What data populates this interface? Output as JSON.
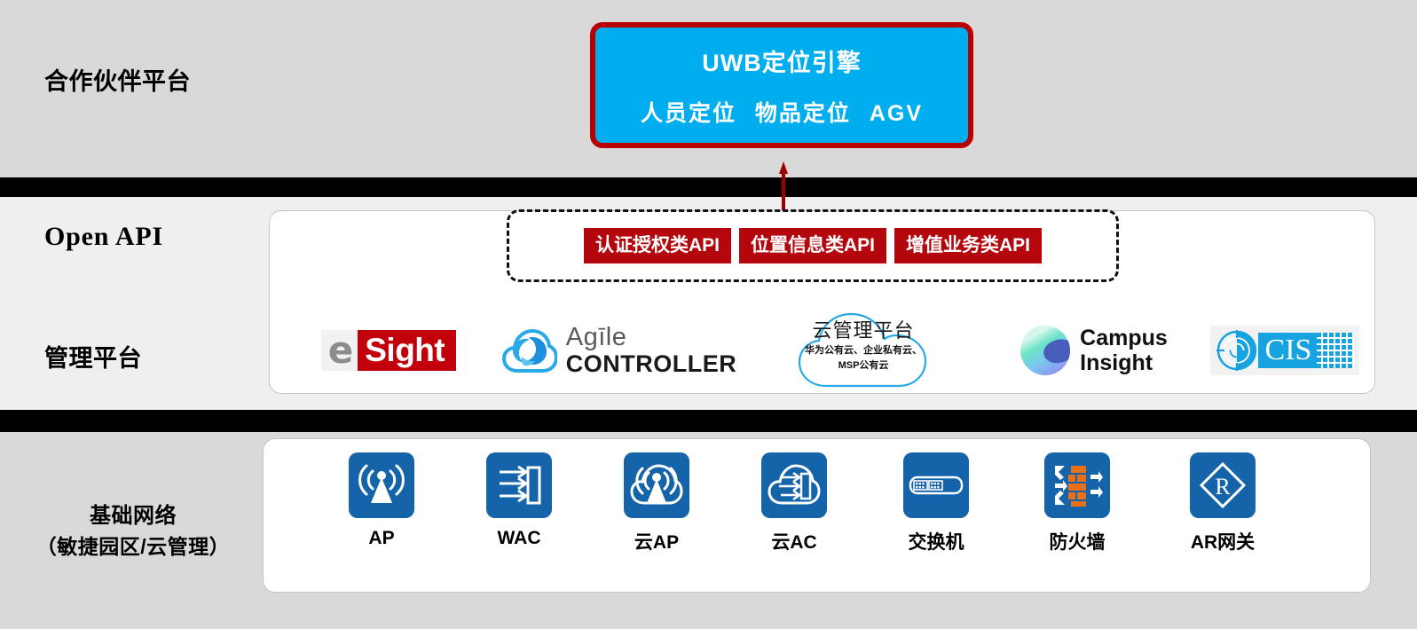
{
  "rows": {
    "partner": {
      "label": "合作伙伴平台"
    },
    "open_api": {
      "label": "Open API"
    },
    "management": {
      "label": "管理平台"
    },
    "network": {
      "label": "基础网络",
      "sub_label": "（敏捷园区/云管理）"
    }
  },
  "uwb_engine": {
    "title": "UWB定位引擎",
    "capabilities": [
      "人员定位",
      "物品定位",
      "AGV"
    ],
    "fill_color": "#00adef",
    "border_color": "#b80000"
  },
  "arrow": {
    "name": "upward-arrow",
    "color": "#b80000"
  },
  "api_group": {
    "chips": [
      {
        "label": "认证授权类API"
      },
      {
        "label": "位置信息类API"
      },
      {
        "label": "增值业务类API"
      }
    ],
    "chip_color": "#b3060d",
    "border_style": "dashed-black"
  },
  "management_platforms": [
    {
      "id": "esight",
      "letter": "e",
      "word": "Sight",
      "accent": "#c2000b"
    },
    {
      "id": "agile-controller",
      "line1": "Agīle",
      "line2": "CONTROLLER",
      "accent": "#29a9e8"
    },
    {
      "id": "cloud-management",
      "title": "云管理平台",
      "sub_line1": "华为公有云、企业私有云、",
      "sub_line2": "MSP公有云",
      "accent": "#29a9e8"
    },
    {
      "id": "campus-insight",
      "line1": "Campus",
      "line2": "Insight",
      "accent": "#6fe3c8"
    },
    {
      "id": "cis",
      "word": "CIS",
      "accent": "#17a3e0"
    }
  ],
  "network_devices": [
    {
      "id": "ap",
      "label": "AP",
      "icon": "wireless-ap-icon"
    },
    {
      "id": "wac",
      "label": "WAC",
      "icon": "wlan-controller-icon"
    },
    {
      "id": "cloud-ap",
      "label": "云AP",
      "icon": "cloud-ap-icon"
    },
    {
      "id": "cloud-ac",
      "label": "云AC",
      "icon": "cloud-ac-icon"
    },
    {
      "id": "switch",
      "label": "交换机",
      "icon": "switch-icon"
    },
    {
      "id": "firewall",
      "label": "防火墙",
      "icon": "firewall-icon"
    },
    {
      "id": "ar-gateway",
      "label": "AR网关",
      "icon": "router-diamond-icon"
    }
  ],
  "colors": {
    "band_gray": "#d9d9d9",
    "band_light": "#efefef",
    "divider": "#000000",
    "device_blue": "#1563a8",
    "firewall_brick": "#e8701a"
  }
}
